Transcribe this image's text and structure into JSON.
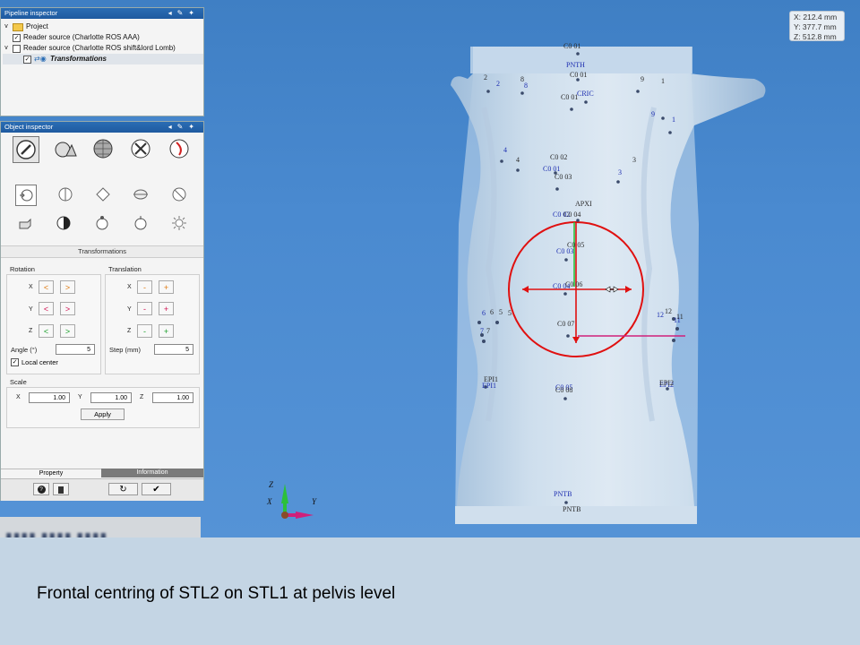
{
  "pipeline_inspector": {
    "title": "Pipeline inspector",
    "tree": [
      {
        "label": "Project"
      },
      {
        "label": "Reader source (Charlotte ROS AAA)"
      },
      {
        "label": "Reader source (Charlotte ROS shift&lord Lomb)"
      },
      {
        "label": "Transformations"
      }
    ]
  },
  "object_inspector": {
    "title": "Object inspector",
    "section_title": "Transformations",
    "rotation": {
      "label": "Rotation",
      "axes": [
        "X",
        "Y",
        "Z"
      ],
      "btn_minus": "<",
      "btn_plus": ">",
      "angle_label": "Angle (°)",
      "angle_value": "5",
      "local_center_label": "Local center"
    },
    "translation": {
      "label": "Translation",
      "axes": [
        "X",
        "Y",
        "Z"
      ],
      "btn_minus": "-",
      "btn_plus": "+",
      "step_label": "Step (mm)",
      "step_value": "5"
    },
    "scale": {
      "label": "Scale",
      "x_label": "X",
      "x_value": "1.00",
      "y_label": "Y",
      "y_value": "1.00",
      "z_label": "Z",
      "z_value": "1.00",
      "apply_label": "Apply"
    },
    "tabs": [
      "Property",
      "Information"
    ]
  },
  "coords": {
    "x": "X: 212.4 mm",
    "y": "Y: 377.7 mm",
    "z": "Z: 512.8 mm"
  },
  "axes_triad": {
    "z": "Z",
    "x": "X",
    "y": "Y"
  },
  "landmarks": {
    "top1": "C0 01",
    "top2": "PNTH",
    "top3": "C0 01",
    "top4": "CRIC",
    "top5": "C0 01",
    "mid1": "C0 02",
    "mid2": "C0 01",
    "mid3": "C0 03",
    "apxi": "APXI",
    "xiph1": "C0 02",
    "xiph2": "C0 04",
    "c05": "C0 05",
    "c03b": "C0 03",
    "c06": "C0 06",
    "c04": "C0 04",
    "c07": "C0 07",
    "epil1": "EPI1",
    "epil2": "EPI1",
    "epir1": "EPI2",
    "epir2": "EPI2",
    "c05b": "C0 05",
    "c08": "C0 08",
    "pntb1": "PNTB",
    "pntb2": "PNTB",
    "n2a": "2",
    "n2b": "2",
    "n8a": "8",
    "n8b": "8",
    "n9a": "9",
    "n1a": "1",
    "n9b": "9",
    "n1b": "1",
    "n4a": "4",
    "n4b": "4",
    "n3a": "3",
    "n3b": "3",
    "n6a": "6",
    "n6b": "6",
    "n5a": "5",
    "n5b": "5",
    "n7a": "7",
    "n7b": "7",
    "n12a": "12",
    "n12b": "12",
    "n11a": "11",
    "n11b": "11"
  },
  "caption": "Frontal centring of STL2 on STL1 at pelvis level",
  "colors": {
    "viewport": "#4a8ad0",
    "panel_header": "#1f5aa0",
    "red_ring": "#e01010",
    "green_axis": "#2cc03a",
    "magenta_axis": "#d0207a",
    "caption_bg": "#c4d5e4"
  }
}
